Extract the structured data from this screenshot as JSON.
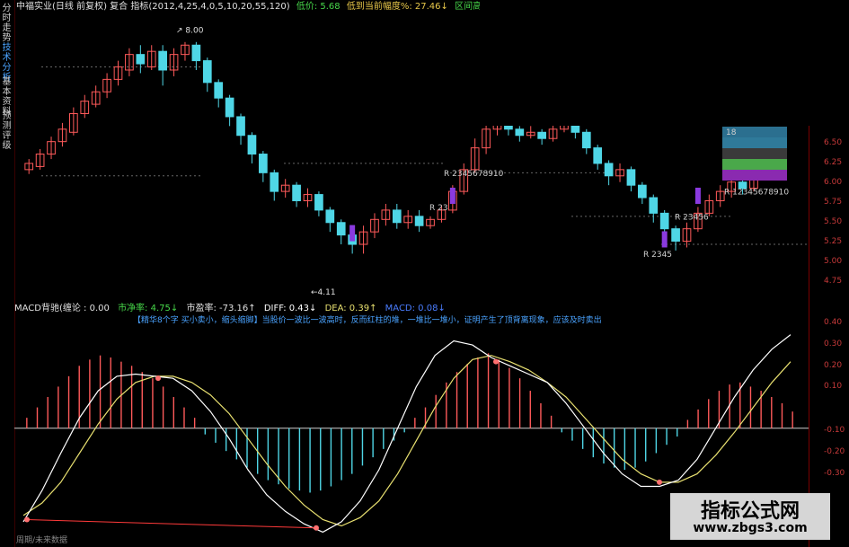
{
  "sidebar": {
    "tabs": [
      {
        "label": "分时走势",
        "active": false
      },
      {
        "label": "技术分析",
        "active": true
      },
      {
        "label": "基本资料",
        "active": false
      },
      {
        "label": "预测评级",
        "active": false
      }
    ]
  },
  "header": {
    "stock": "中福实业(日线 前复权) 复合 指标(2012,4,25,4,0,5,10,20,55,120)",
    "low_label": "低价: 5.68",
    "drop_label": "低到当前幅度%: 27.46↓",
    "range_label": "区间高"
  },
  "price_chart": {
    "high_marker": "8.00",
    "low_marker": "4.11",
    "y_ticks": [
      "6.50",
      "6.25",
      "6.00",
      "5.75",
      "5.50",
      "5.25",
      "5.00",
      "4.75"
    ],
    "signals": [
      {
        "text": "2345678910"
      },
      {
        "text": "23"
      },
      {
        "text": "2345678910"
      },
      {
        "text": "23456"
      },
      {
        "text": "2345"
      },
      {
        "text": "12345678910"
      }
    ],
    "signal_prefix": "R",
    "panel_label": "18",
    "candles": [
      {
        "o": 5.95,
        "c": 6.05,
        "h": 6.12,
        "l": 5.88
      },
      {
        "o": 6.0,
        "c": 6.2,
        "h": 6.28,
        "l": 5.95
      },
      {
        "o": 6.2,
        "c": 6.4,
        "h": 6.48,
        "l": 6.12
      },
      {
        "o": 6.4,
        "c": 6.6,
        "h": 6.7,
        "l": 6.32
      },
      {
        "o": 6.55,
        "c": 6.85,
        "h": 6.95,
        "l": 6.5
      },
      {
        "o": 6.85,
        "c": 7.05,
        "h": 7.15,
        "l": 6.78
      },
      {
        "o": 7.0,
        "c": 7.2,
        "h": 7.3,
        "l": 6.95
      },
      {
        "o": 7.2,
        "c": 7.4,
        "h": 7.5,
        "l": 7.1
      },
      {
        "o": 7.4,
        "c": 7.6,
        "h": 7.7,
        "l": 7.3
      },
      {
        "o": 7.55,
        "c": 7.8,
        "h": 7.9,
        "l": 7.45
      },
      {
        "o": 7.8,
        "c": 7.65,
        "h": 7.95,
        "l": 7.5
      },
      {
        "o": 7.6,
        "c": 7.85,
        "h": 7.95,
        "l": 7.55
      },
      {
        "o": 7.85,
        "c": 7.55,
        "h": 7.95,
        "l": 7.3
      },
      {
        "o": 7.55,
        "c": 7.8,
        "h": 7.9,
        "l": 7.45
      },
      {
        "o": 7.8,
        "c": 7.95,
        "h": 8.0,
        "l": 7.7
      },
      {
        "o": 7.95,
        "c": 7.7,
        "h": 8.0,
        "l": 7.55
      },
      {
        "o": 7.7,
        "c": 7.35,
        "h": 7.75,
        "l": 7.2
      },
      {
        "o": 7.35,
        "c": 7.1,
        "h": 7.4,
        "l": 6.95
      },
      {
        "o": 7.1,
        "c": 6.8,
        "h": 7.15,
        "l": 6.65
      },
      {
        "o": 6.8,
        "c": 6.5,
        "h": 6.85,
        "l": 6.35
      },
      {
        "o": 6.5,
        "c": 6.2,
        "h": 6.55,
        "l": 6.05
      },
      {
        "o": 6.2,
        "c": 5.9,
        "h": 6.25,
        "l": 5.75
      },
      {
        "o": 5.9,
        "c": 5.6,
        "h": 5.95,
        "l": 5.45
      },
      {
        "o": 5.6,
        "c": 5.7,
        "h": 5.8,
        "l": 5.5
      },
      {
        "o": 5.7,
        "c": 5.45,
        "h": 5.75,
        "l": 5.35
      },
      {
        "o": 5.45,
        "c": 5.55,
        "h": 5.65,
        "l": 5.35
      },
      {
        "o": 5.55,
        "c": 5.3,
        "h": 5.6,
        "l": 5.2
      },
      {
        "o": 5.3,
        "c": 5.1,
        "h": 5.35,
        "l": 4.95
      },
      {
        "o": 5.1,
        "c": 4.9,
        "h": 5.15,
        "l": 4.75
      },
      {
        "o": 4.9,
        "c": 4.75,
        "h": 4.95,
        "l": 4.6
      },
      {
        "o": 4.75,
        "c": 4.95,
        "h": 5.05,
        "l": 4.6
      },
      {
        "o": 4.95,
        "c": 5.15,
        "h": 5.25,
        "l": 4.85
      },
      {
        "o": 5.15,
        "c": 5.3,
        "h": 5.4,
        "l": 5.05
      },
      {
        "o": 5.3,
        "c": 5.1,
        "h": 5.4,
        "l": 5.0
      },
      {
        "o": 5.1,
        "c": 5.2,
        "h": 5.3,
        "l": 5.0
      },
      {
        "o": 5.2,
        "c": 5.05,
        "h": 5.3,
        "l": 4.95
      },
      {
        "o": 5.05,
        "c": 5.15,
        "h": 5.2,
        "l": 5.0
      },
      {
        "o": 5.15,
        "c": 5.3,
        "h": 5.38,
        "l": 5.1
      },
      {
        "o": 5.3,
        "c": 5.6,
        "h": 5.7,
        "l": 5.25
      },
      {
        "o": 5.6,
        "c": 5.95,
        "h": 6.05,
        "l": 5.55
      },
      {
        "o": 5.95,
        "c": 6.3,
        "h": 6.45,
        "l": 5.9
      },
      {
        "o": 6.3,
        "c": 6.6,
        "h": 6.7,
        "l": 6.2
      },
      {
        "o": 6.6,
        "c": 6.75,
        "h": 6.85,
        "l": 6.5
      },
      {
        "o": 6.75,
        "c": 6.6,
        "h": 6.8,
        "l": 6.5
      },
      {
        "o": 6.6,
        "c": 6.5,
        "h": 6.65,
        "l": 6.4
      },
      {
        "o": 6.5,
        "c": 6.55,
        "h": 6.65,
        "l": 6.45
      },
      {
        "o": 6.55,
        "c": 6.45,
        "h": 6.6,
        "l": 6.35
      },
      {
        "o": 6.45,
        "c": 6.6,
        "h": 6.7,
        "l": 6.4
      },
      {
        "o": 6.6,
        "c": 6.7,
        "h": 6.8,
        "l": 6.55
      },
      {
        "o": 6.7,
        "c": 6.55,
        "h": 6.75,
        "l": 6.45
      },
      {
        "o": 6.55,
        "c": 6.3,
        "h": 6.6,
        "l": 6.2
      },
      {
        "o": 6.3,
        "c": 6.05,
        "h": 6.35,
        "l": 5.95
      },
      {
        "o": 6.05,
        "c": 5.85,
        "h": 6.1,
        "l": 5.7
      },
      {
        "o": 5.85,
        "c": 5.95,
        "h": 6.05,
        "l": 5.75
      },
      {
        "o": 5.95,
        "c": 5.7,
        "h": 6.0,
        "l": 5.6
      },
      {
        "o": 5.7,
        "c": 5.5,
        "h": 5.75,
        "l": 5.4
      },
      {
        "o": 5.5,
        "c": 5.25,
        "h": 5.55,
        "l": 5.1
      },
      {
        "o": 5.25,
        "c": 5.0,
        "h": 5.3,
        "l": 4.85
      },
      {
        "o": 5.0,
        "c": 4.8,
        "h": 5.05,
        "l": 4.65
      },
      {
        "o": 4.8,
        "c": 5.0,
        "h": 5.1,
        "l": 4.7
      },
      {
        "o": 5.0,
        "c": 5.25,
        "h": 5.35,
        "l": 4.95
      },
      {
        "o": 5.25,
        "c": 5.45,
        "h": 5.55,
        "l": 5.2
      },
      {
        "o": 5.45,
        "c": 5.6,
        "h": 5.7,
        "l": 5.35
      },
      {
        "o": 5.6,
        "c": 5.75,
        "h": 5.85,
        "l": 5.5
      },
      {
        "o": 5.75,
        "c": 5.65,
        "h": 5.8,
        "l": 5.55
      },
      {
        "o": 5.65,
        "c": 5.85,
        "h": 5.95,
        "l": 5.6
      },
      {
        "o": 5.85,
        "c": 6.15,
        "h": 6.3,
        "l": 5.8
      },
      {
        "o": 6.15,
        "c": 6.45,
        "h": 6.6,
        "l": 6.1
      }
    ]
  },
  "macd": {
    "title": "MACD背驰(缠论 : 0.00",
    "pe_net": "市净率: 4.75↓",
    "pe_ratio": "市盈率: -73.16↑",
    "diff": "DIFF: 0.43↓",
    "dea": "DEA: 0.39↑",
    "macd_val": "MACD: 0.08↓",
    "banner": "【精华8个字 买小卖小，缩头缩脚】当股价一波比一波高时，反而红柱的堆，一堆比一堆小，证明产生了顶背离现象，应该及时卖出",
    "y_ticks": [
      "0.40",
      "0.30",
      "0.20",
      "0.10",
      "-0.10",
      "-0.20",
      "-0.30"
    ],
    "histogram": [
      0.05,
      0.1,
      0.15,
      0.2,
      0.25,
      0.3,
      0.33,
      0.35,
      0.34,
      0.32,
      0.3,
      0.27,
      0.24,
      0.2,
      0.15,
      0.1,
      0.05,
      -0.03,
      -0.07,
      -0.11,
      -0.15,
      -0.19,
      -0.22,
      -0.25,
      -0.27,
      -0.29,
      -0.3,
      -0.31,
      -0.3,
      -0.28,
      -0.25,
      -0.22,
      -0.18,
      -0.14,
      -0.1,
      -0.06,
      -0.02,
      0.05,
      0.1,
      0.16,
      0.22,
      0.27,
      0.31,
      0.34,
      0.36,
      0.33,
      0.29,
      0.24,
      0.18,
      0.12,
      0.06,
      -0.02,
      -0.06,
      -0.1,
      -0.14,
      -0.17,
      -0.19,
      -0.2,
      -0.19,
      -0.16,
      -0.12,
      -0.08,
      -0.04,
      0.04,
      0.09,
      0.14,
      0.18,
      0.21,
      0.22,
      0.2,
      0.18,
      0.15,
      0.12,
      0.08
    ],
    "diff_line": [
      -0.45,
      -0.3,
      -0.12,
      0.05,
      0.18,
      0.25,
      0.26,
      0.25,
      0.24,
      0.18,
      0.08,
      -0.05,
      -0.2,
      -0.32,
      -0.4,
      -0.46,
      -0.5,
      -0.45,
      -0.35,
      -0.2,
      0.0,
      0.2,
      0.35,
      0.42,
      0.4,
      0.34,
      0.3,
      0.26,
      0.22,
      0.12,
      0.0,
      -0.12,
      -0.22,
      -0.28,
      -0.28,
      -0.25,
      -0.15,
      0.0,
      0.15,
      0.28,
      0.38,
      0.45
    ],
    "dea_line": [
      -0.42,
      -0.36,
      -0.26,
      -0.12,
      0.02,
      0.14,
      0.22,
      0.25,
      0.25,
      0.22,
      0.16,
      0.07,
      -0.05,
      -0.17,
      -0.28,
      -0.37,
      -0.44,
      -0.47,
      -0.43,
      -0.35,
      -0.22,
      -0.06,
      0.1,
      0.24,
      0.33,
      0.35,
      0.32,
      0.28,
      0.22,
      0.15,
      0.05,
      -0.05,
      -0.15,
      -0.22,
      -0.26,
      -0.26,
      -0.22,
      -0.13,
      -0.02,
      0.1,
      0.22,
      0.32
    ]
  },
  "watermark": {
    "title": "指标公式网",
    "url": "www.zbgs3.com"
  },
  "footer": {
    "text": "周期/未来数据"
  },
  "colors": {
    "up": "#ff5a5a",
    "down": "#4fd6e6",
    "diff": "#ffffff",
    "dea": "#e8e070",
    "axis": "#c83a3a",
    "signal_bar": "#8a3adf"
  }
}
